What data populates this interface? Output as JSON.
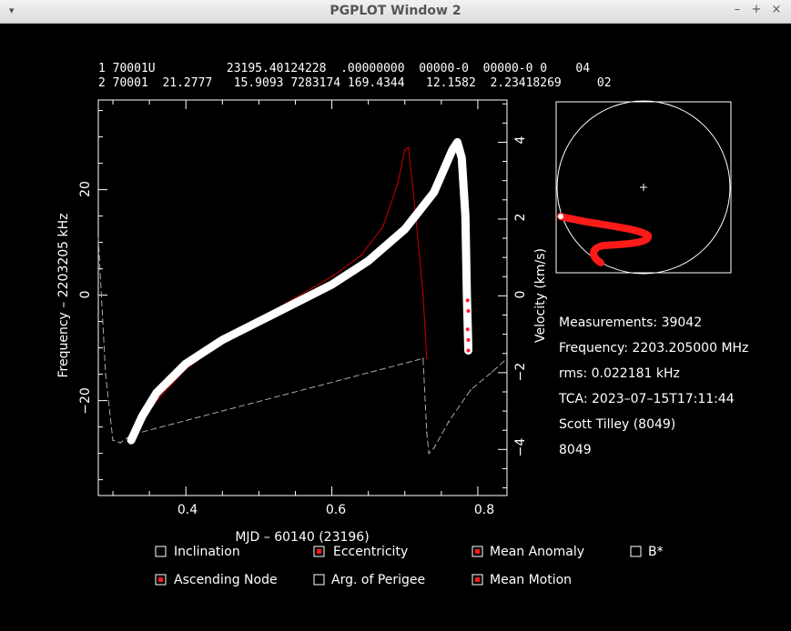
{
  "window": {
    "title": "PGPLOT Window 2",
    "controls": [
      "▾",
      "–",
      "+",
      "×"
    ]
  },
  "tle": {
    "line1": "1 70001U          23195.40124228  .00000000  00000-0  00000-0 0    04",
    "line2": "2 70001  21.2777   15.9093 7283174 169.4344   12.1582  2.23418269     02"
  },
  "axes": {
    "xlabel": "MJD – 60140 (23196)",
    "ylabel_left": "Frequency – 2203205 kHz",
    "ylabel_right": "Velocity (km/s)",
    "x_ticks": [
      "0.4",
      "0.6",
      "0.8"
    ],
    "y_left_ticks": [
      "20",
      "0",
      "−20"
    ],
    "y_right_ticks": [
      "4",
      "2",
      "0",
      "−2",
      "−4"
    ]
  },
  "info": {
    "measurements": "Measurements: 39042",
    "frequency": "Frequency: 2203.205000 MHz",
    "rms": "rms: 0.022181 kHz",
    "tca": "TCA: 2023–07–15T17:11:44",
    "observer": "Scott Tilley (8049)",
    "site": "8049",
    "site_color": "#ff2020"
  },
  "checkboxes": [
    {
      "label": "Inclination",
      "checked": false
    },
    {
      "label": "Eccentricity",
      "checked": true
    },
    {
      "label": "Mean Anomaly",
      "checked": true
    },
    {
      "label": "B*",
      "checked": false
    },
    {
      "label": "Ascending Node",
      "checked": true
    },
    {
      "label": "Arg. of Perigee",
      "checked": false
    },
    {
      "label": "Mean Motion",
      "checked": true
    }
  ],
  "chart_data": {
    "type": "scatter",
    "xlabel": "MJD – 60140 (23196)",
    "ylabel": "Frequency – 2203205 kHz",
    "y2label": "Velocity (km/s)",
    "xlim": [
      0.28,
      0.84
    ],
    "ylim": [
      -38,
      37
    ],
    "y2lim": [
      -5.2,
      5.1
    ],
    "series": [
      {
        "color": "#ffffff",
        "points": [
          [
            0.325,
            -27.5
          ],
          [
            0.34,
            -23
          ],
          [
            0.36,
            -18.5
          ],
          [
            0.4,
            -13
          ],
          [
            0.45,
            -8.5
          ],
          [
            0.5,
            -5
          ],
          [
            0.55,
            -1.5
          ],
          [
            0.6,
            2
          ],
          [
            0.65,
            6.5
          ],
          [
            0.7,
            12.5
          ],
          [
            0.74,
            19.5
          ],
          [
            0.765,
            27.5
          ],
          [
            0.772,
            29
          ],
          [
            0.778,
            26
          ],
          [
            0.783,
            15
          ],
          [
            0.785,
            0
          ],
          [
            0.786,
            -5
          ],
          [
            0.787,
            -10.5
          ]
        ]
      },
      {
        "color": "#cc0000",
        "points": [
          [
            0.325,
            -27
          ],
          [
            0.36,
            -20
          ],
          [
            0.4,
            -14
          ],
          [
            0.45,
            -9
          ],
          [
            0.5,
            -4.5
          ],
          [
            0.55,
            -0.5
          ],
          [
            0.6,
            3.5
          ],
          [
            0.64,
            7.5
          ],
          [
            0.67,
            13
          ],
          [
            0.69,
            21
          ],
          [
            0.7,
            27.5
          ],
          [
            0.705,
            28
          ],
          [
            0.715,
            15
          ],
          [
            0.725,
            0
          ],
          [
            0.73,
            -12
          ]
        ]
      },
      {
        "color": "#aaaaaa",
        "points": [
          [
            0.28,
            11
          ],
          [
            0.29,
            -15
          ],
          [
            0.3,
            -27.5
          ],
          [
            0.31,
            -28
          ],
          [
            0.325,
            -26.5
          ],
          [
            0.725,
            -12
          ],
          [
            0.73,
            -26
          ],
          [
            0.733,
            -30
          ],
          [
            0.74,
            -29
          ],
          [
            0.76,
            -24
          ],
          [
            0.79,
            -18
          ],
          [
            0.82,
            -14.5
          ],
          [
            0.84,
            -12
          ]
        ]
      }
    ]
  }
}
